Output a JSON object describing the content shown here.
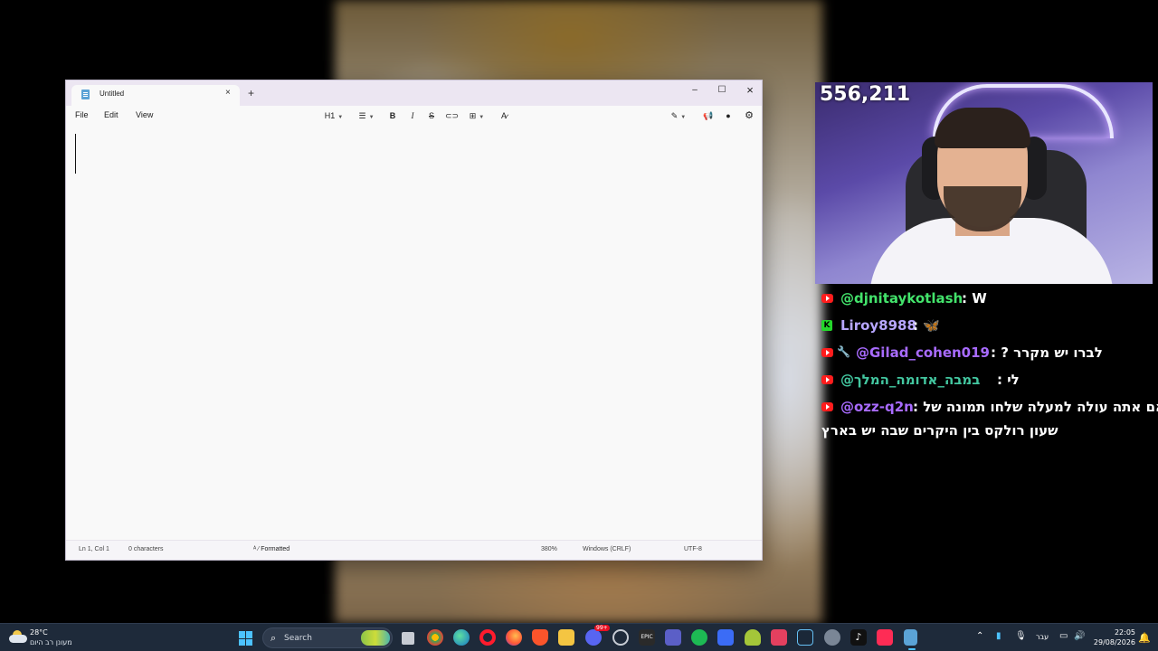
{
  "notepad": {
    "tab_title": "Untitled",
    "new_tab": "+",
    "tab_close": "×",
    "controls": {
      "minimize": "–",
      "maximize": "☐",
      "close": "×"
    },
    "menu": [
      "File",
      "Edit",
      "View"
    ],
    "toolbar": {
      "heading": "H1",
      "bold": "B",
      "italic": "I",
      "strike": "S"
    },
    "status": {
      "position": "Ln 1, Col 1",
      "characters": "0 characters",
      "format": "Formatted",
      "zoom": "380%",
      "line_endings": "Windows (CRLF)",
      "encoding": "UTF-8"
    }
  },
  "stream": {
    "viewers": "556,211",
    "chat": [
      {
        "platform": "youtube",
        "user": "@djnitaykotlash",
        "sep": " : ",
        "message": "W",
        "user_color": "#43e36b"
      },
      {
        "platform": "kick",
        "user": "Liroy8988",
        "sep": " : ",
        "message": "🦋",
        "user_color": "#b7a6ff"
      },
      {
        "platform": "youtube",
        "badge": "wrench",
        "user": "@Gilad_cohen019",
        "sep": " : ",
        "message": "? לברו יש מקרר",
        "user_color": "#a86bff"
      },
      {
        "platform": "youtube",
        "user": "@במבה_אדומה_המלך",
        "sep": " : ",
        "message": "לי",
        "user_color": "#43c7a0"
      },
      {
        "platform": "youtube",
        "user": "@ozz-q2n",
        "sep": " : ",
        "message": "אם אתה עולה למעלה שלחו תמונה של",
        "message2": "שעון רולקס בין היקרים שבה יש בארץ",
        "user_color": "#a86bff"
      }
    ]
  },
  "taskbar": {
    "weather": {
      "temp": "28°C",
      "condition": "מעונן רב היום"
    },
    "search_label": "Search",
    "discord_badge": "99+",
    "tray": {
      "language": "עבר"
    },
    "clock": {
      "time": "22:05",
      "date": "29/08/2026"
    }
  }
}
